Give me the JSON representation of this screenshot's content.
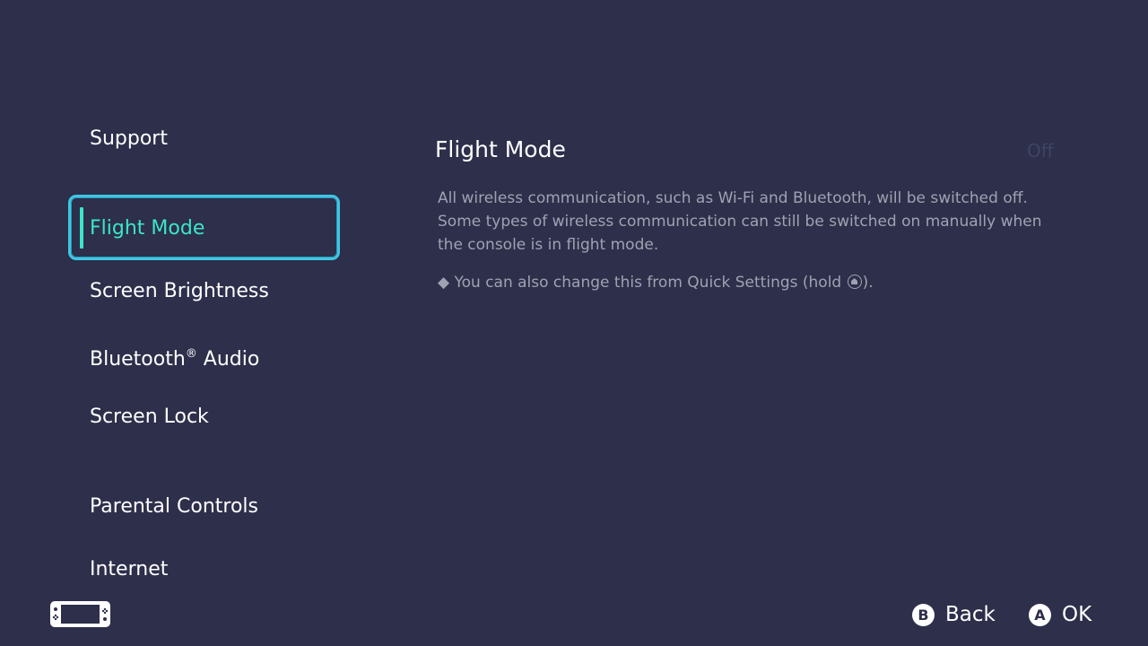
{
  "sidebar": {
    "items": [
      {
        "label": "Support"
      },
      {
        "label": "Flight Mode",
        "selected": true
      },
      {
        "label": "Screen Brightness"
      },
      {
        "label": "Bluetooth",
        "label_sup": "®",
        "label_suffix": " Audio"
      },
      {
        "label": "Screen Lock"
      },
      {
        "label": "Parental Controls"
      },
      {
        "label": "Internet"
      }
    ]
  },
  "main": {
    "title": "Flight Mode",
    "value": "Off",
    "description": "All wireless communication, such as Wi-Fi and Bluetooth, will be switched off. Some types of wireless communication can still be switched on manually when the console is in flight mode.",
    "note_bullet": "◆",
    "note_prefix": "You can also change this from Quick Settings (hold ",
    "note_suffix": ")."
  },
  "footer": {
    "back": {
      "glyph": "B",
      "label": "Back"
    },
    "ok": {
      "glyph": "A",
      "label": "OK"
    }
  },
  "icons": {
    "console": "console-handheld-icon",
    "home": "home-button-icon"
  },
  "colors": {
    "background": "#2d2f4b",
    "accent": "#3be6c9",
    "focus_border": "#3fc6e3",
    "text": "#ffffff",
    "muted_text": "#a0a2b2"
  }
}
